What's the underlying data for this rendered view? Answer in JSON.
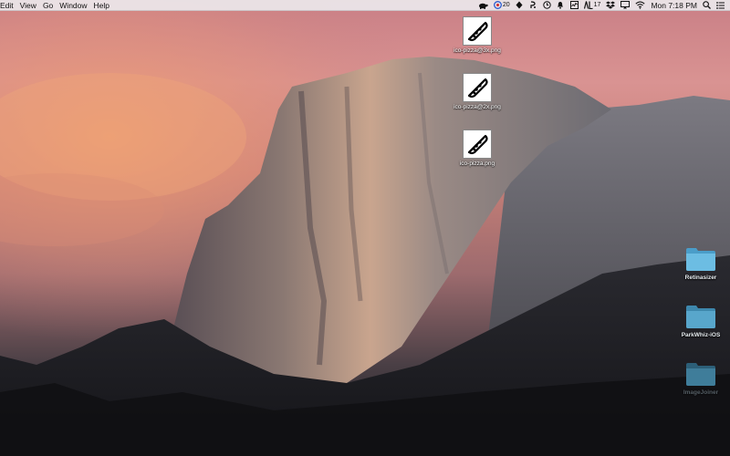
{
  "menubar": {
    "items": [
      {
        "label": "Edit"
      },
      {
        "label": "View"
      },
      {
        "label": "Go"
      },
      {
        "label": "Window"
      },
      {
        "label": "Help"
      }
    ],
    "tray": {
      "badge_count": "20",
      "notification_count": "17",
      "clock": "Mon 7:18 PM"
    }
  },
  "desktop": {
    "files": [
      {
        "label": "ico-pizza@3x.png"
      },
      {
        "label": "ico-pizza@2x.png"
      },
      {
        "label": "ico-pizza.png"
      }
    ],
    "folders": [
      {
        "label": "Retinasizer"
      },
      {
        "label": "ParkWhiz-iOS"
      },
      {
        "label": "ImageJoiner"
      }
    ]
  },
  "colors": {
    "menubar_bg": "#ece8ec",
    "folder_blue": "#5fb0d8"
  }
}
